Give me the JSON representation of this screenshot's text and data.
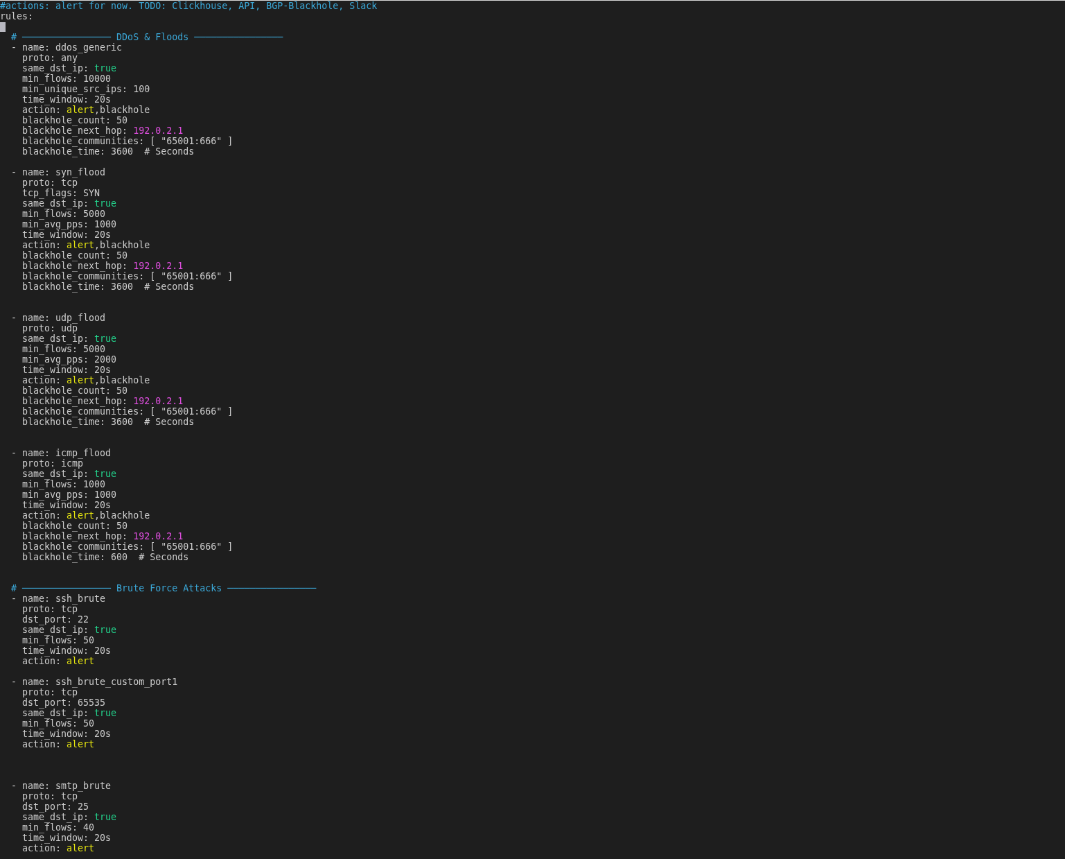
{
  "lines": [
    {
      "kind": "text",
      "parts": [
        {
          "kind": "comment",
          "text": "#actions: alert for now. TODO: Clickhouse, API, BGP-Blackhole, Slack"
        }
      ]
    },
    {
      "kind": "text",
      "parts": [
        {
          "kind": "plain",
          "text": "rules:"
        }
      ]
    },
    {
      "kind": "cursor"
    },
    {
      "kind": "text",
      "parts": [
        {
          "kind": "comment",
          "text": "  # ──────────────── DDoS & Floods ────────────────"
        }
      ]
    },
    {
      "kind": "text",
      "parts": [
        {
          "kind": "plain",
          "text": "  - name: ddos_generic"
        }
      ]
    },
    {
      "kind": "text",
      "parts": [
        {
          "kind": "plain",
          "text": "    proto: any"
        }
      ]
    },
    {
      "kind": "text",
      "parts": [
        {
          "kind": "plain",
          "text": "    same_dst_ip: "
        },
        {
          "kind": "bool",
          "text": "true"
        }
      ]
    },
    {
      "kind": "text",
      "parts": [
        {
          "kind": "plain",
          "text": "    min_flows: 10000"
        }
      ]
    },
    {
      "kind": "text",
      "parts": [
        {
          "kind": "plain",
          "text": "    min_unique_src_ips: 100"
        }
      ]
    },
    {
      "kind": "text",
      "parts": [
        {
          "kind": "plain",
          "text": "    time_window: 20s"
        }
      ]
    },
    {
      "kind": "text",
      "parts": [
        {
          "kind": "plain",
          "text": "    action: "
        },
        {
          "kind": "keyword",
          "text": "alert"
        },
        {
          "kind": "plain",
          "text": ",blackhole"
        }
      ]
    },
    {
      "kind": "text",
      "parts": [
        {
          "kind": "plain",
          "text": "    blackhole_count: 50"
        }
      ]
    },
    {
      "kind": "text",
      "parts": [
        {
          "kind": "plain",
          "text": "    blackhole_next_hop: "
        },
        {
          "kind": "ip",
          "text": "192.0.2.1"
        }
      ]
    },
    {
      "kind": "text",
      "parts": [
        {
          "kind": "plain",
          "text": "    blackhole_communities: [ \"65001:666\" ]"
        }
      ]
    },
    {
      "kind": "text",
      "parts": [
        {
          "kind": "plain",
          "text": "    blackhole_time: 3600  # Seconds"
        }
      ]
    },
    {
      "kind": "blank"
    },
    {
      "kind": "text",
      "parts": [
        {
          "kind": "plain",
          "text": "  - name: syn_flood"
        }
      ]
    },
    {
      "kind": "text",
      "parts": [
        {
          "kind": "plain",
          "text": "    proto: tcp"
        }
      ]
    },
    {
      "kind": "text",
      "parts": [
        {
          "kind": "plain",
          "text": "    tcp_flags: SYN"
        }
      ]
    },
    {
      "kind": "text",
      "parts": [
        {
          "kind": "plain",
          "text": "    same_dst_ip: "
        },
        {
          "kind": "bool",
          "text": "true"
        }
      ]
    },
    {
      "kind": "text",
      "parts": [
        {
          "kind": "plain",
          "text": "    min_flows: 5000"
        }
      ]
    },
    {
      "kind": "text",
      "parts": [
        {
          "kind": "plain",
          "text": "    min_avg_pps: 1000"
        }
      ]
    },
    {
      "kind": "text",
      "parts": [
        {
          "kind": "plain",
          "text": "    time_window: 20s"
        }
      ]
    },
    {
      "kind": "text",
      "parts": [
        {
          "kind": "plain",
          "text": "    action: "
        },
        {
          "kind": "keyword",
          "text": "alert"
        },
        {
          "kind": "plain",
          "text": ",blackhole"
        }
      ]
    },
    {
      "kind": "text",
      "parts": [
        {
          "kind": "plain",
          "text": "    blackhole_count: 50"
        }
      ]
    },
    {
      "kind": "text",
      "parts": [
        {
          "kind": "plain",
          "text": "    blackhole_next_hop: "
        },
        {
          "kind": "ip",
          "text": "192.0.2.1"
        }
      ]
    },
    {
      "kind": "text",
      "parts": [
        {
          "kind": "plain",
          "text": "    blackhole_communities: [ \"65001:666\" ]"
        }
      ]
    },
    {
      "kind": "text",
      "parts": [
        {
          "kind": "plain",
          "text": "    blackhole_time: 3600  # Seconds"
        }
      ]
    },
    {
      "kind": "blank"
    },
    {
      "kind": "blank"
    },
    {
      "kind": "text",
      "parts": [
        {
          "kind": "plain",
          "text": "  - name: udp_flood"
        }
      ]
    },
    {
      "kind": "text",
      "parts": [
        {
          "kind": "plain",
          "text": "    proto: udp"
        }
      ]
    },
    {
      "kind": "text",
      "parts": [
        {
          "kind": "plain",
          "text": "    same_dst_ip: "
        },
        {
          "kind": "bool",
          "text": "true"
        }
      ]
    },
    {
      "kind": "text",
      "parts": [
        {
          "kind": "plain",
          "text": "    min_flows: 5000"
        }
      ]
    },
    {
      "kind": "text",
      "parts": [
        {
          "kind": "plain",
          "text": "    min_avg_pps: 2000"
        }
      ]
    },
    {
      "kind": "text",
      "parts": [
        {
          "kind": "plain",
          "text": "    time_window: 20s"
        }
      ]
    },
    {
      "kind": "text",
      "parts": [
        {
          "kind": "plain",
          "text": "    action: "
        },
        {
          "kind": "keyword",
          "text": "alert"
        },
        {
          "kind": "plain",
          "text": ",blackhole"
        }
      ]
    },
    {
      "kind": "text",
      "parts": [
        {
          "kind": "plain",
          "text": "    blackhole_count: 50"
        }
      ]
    },
    {
      "kind": "text",
      "parts": [
        {
          "kind": "plain",
          "text": "    blackhole_next_hop: "
        },
        {
          "kind": "ip",
          "text": "192.0.2.1"
        }
      ]
    },
    {
      "kind": "text",
      "parts": [
        {
          "kind": "plain",
          "text": "    blackhole_communities: [ \"65001:666\" ]"
        }
      ]
    },
    {
      "kind": "text",
      "parts": [
        {
          "kind": "plain",
          "text": "    blackhole_time: 3600  # Seconds"
        }
      ]
    },
    {
      "kind": "blank"
    },
    {
      "kind": "blank"
    },
    {
      "kind": "text",
      "parts": [
        {
          "kind": "plain",
          "text": "  - name: icmp_flood"
        }
      ]
    },
    {
      "kind": "text",
      "parts": [
        {
          "kind": "plain",
          "text": "    proto: icmp"
        }
      ]
    },
    {
      "kind": "text",
      "parts": [
        {
          "kind": "plain",
          "text": "    same_dst_ip: "
        },
        {
          "kind": "bool",
          "text": "true"
        }
      ]
    },
    {
      "kind": "text",
      "parts": [
        {
          "kind": "plain",
          "text": "    min_flows: 1000"
        }
      ]
    },
    {
      "kind": "text",
      "parts": [
        {
          "kind": "plain",
          "text": "    min_avg_pps: 1000"
        }
      ]
    },
    {
      "kind": "text",
      "parts": [
        {
          "kind": "plain",
          "text": "    time_window: 20s"
        }
      ]
    },
    {
      "kind": "text",
      "parts": [
        {
          "kind": "plain",
          "text": "    action: "
        },
        {
          "kind": "keyword",
          "text": "alert"
        },
        {
          "kind": "plain",
          "text": ",blackhole"
        }
      ]
    },
    {
      "kind": "text",
      "parts": [
        {
          "kind": "plain",
          "text": "    blackhole_count: 50"
        }
      ]
    },
    {
      "kind": "text",
      "parts": [
        {
          "kind": "plain",
          "text": "    blackhole_next_hop: "
        },
        {
          "kind": "ip",
          "text": "192.0.2.1"
        }
      ]
    },
    {
      "kind": "text",
      "parts": [
        {
          "kind": "plain",
          "text": "    blackhole_communities: [ \"65001:666\" ]"
        }
      ]
    },
    {
      "kind": "text",
      "parts": [
        {
          "kind": "plain",
          "text": "    blackhole_time: 600  # Seconds"
        }
      ]
    },
    {
      "kind": "blank"
    },
    {
      "kind": "blank"
    },
    {
      "kind": "text",
      "parts": [
        {
          "kind": "comment",
          "text": "  # ──────────────── Brute Force Attacks ────────────────"
        }
      ]
    },
    {
      "kind": "text",
      "parts": [
        {
          "kind": "plain",
          "text": "  - name: ssh_brute"
        }
      ]
    },
    {
      "kind": "text",
      "parts": [
        {
          "kind": "plain",
          "text": "    proto: tcp"
        }
      ]
    },
    {
      "kind": "text",
      "parts": [
        {
          "kind": "plain",
          "text": "    dst_port: 22"
        }
      ]
    },
    {
      "kind": "text",
      "parts": [
        {
          "kind": "plain",
          "text": "    same_dst_ip: "
        },
        {
          "kind": "bool",
          "text": "true"
        }
      ]
    },
    {
      "kind": "text",
      "parts": [
        {
          "kind": "plain",
          "text": "    min_flows: 50"
        }
      ]
    },
    {
      "kind": "text",
      "parts": [
        {
          "kind": "plain",
          "text": "    time_window: 20s"
        }
      ]
    },
    {
      "kind": "text",
      "parts": [
        {
          "kind": "plain",
          "text": "    action: "
        },
        {
          "kind": "keyword",
          "text": "alert"
        }
      ]
    },
    {
      "kind": "blank"
    },
    {
      "kind": "text",
      "parts": [
        {
          "kind": "plain",
          "text": "  - name: ssh_brute_custom_port1"
        }
      ]
    },
    {
      "kind": "text",
      "parts": [
        {
          "kind": "plain",
          "text": "    proto: tcp"
        }
      ]
    },
    {
      "kind": "text",
      "parts": [
        {
          "kind": "plain",
          "text": "    dst_port: 65535"
        }
      ]
    },
    {
      "kind": "text",
      "parts": [
        {
          "kind": "plain",
          "text": "    same_dst_ip: "
        },
        {
          "kind": "bool",
          "text": "true"
        }
      ]
    },
    {
      "kind": "text",
      "parts": [
        {
          "kind": "plain",
          "text": "    min_flows: 50"
        }
      ]
    },
    {
      "kind": "text",
      "parts": [
        {
          "kind": "plain",
          "text": "    time_window: 20s"
        }
      ]
    },
    {
      "kind": "text",
      "parts": [
        {
          "kind": "plain",
          "text": "    action: "
        },
        {
          "kind": "keyword",
          "text": "alert"
        }
      ]
    },
    {
      "kind": "blank"
    },
    {
      "kind": "blank"
    },
    {
      "kind": "blank"
    },
    {
      "kind": "text",
      "parts": [
        {
          "kind": "plain",
          "text": "  - name: smtp_brute"
        }
      ]
    },
    {
      "kind": "text",
      "parts": [
        {
          "kind": "plain",
          "text": "    proto: tcp"
        }
      ]
    },
    {
      "kind": "text",
      "parts": [
        {
          "kind": "plain",
          "text": "    dst_port: 25"
        }
      ]
    },
    {
      "kind": "text",
      "parts": [
        {
          "kind": "plain",
          "text": "    same_dst_ip: "
        },
        {
          "kind": "bool",
          "text": "true"
        }
      ]
    },
    {
      "kind": "text",
      "parts": [
        {
          "kind": "plain",
          "text": "    min_flows: 40"
        }
      ]
    },
    {
      "kind": "text",
      "parts": [
        {
          "kind": "plain",
          "text": "    time_window: 20s"
        }
      ]
    },
    {
      "kind": "text",
      "parts": [
        {
          "kind": "plain",
          "text": "    action: "
        },
        {
          "kind": "keyword",
          "text": "alert"
        }
      ]
    }
  ]
}
